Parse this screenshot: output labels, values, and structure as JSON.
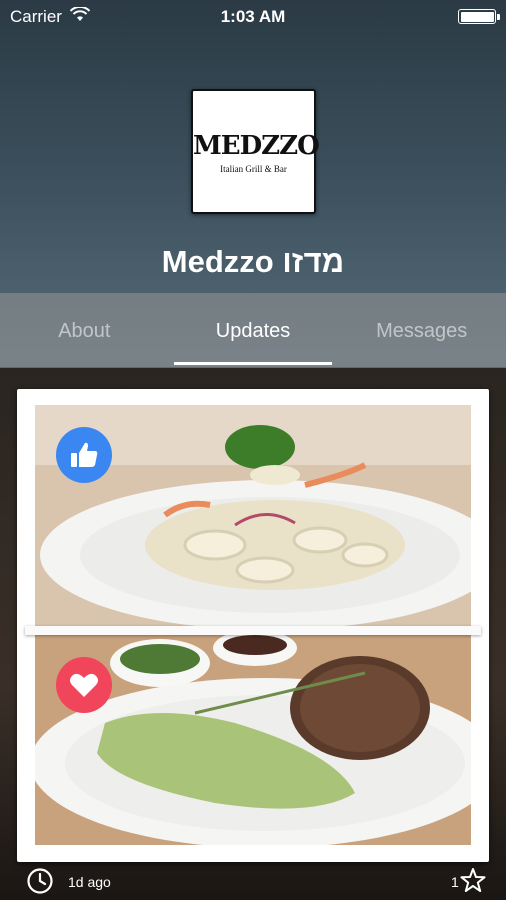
{
  "status_bar": {
    "carrier": "Carrier",
    "time": "1:03 AM"
  },
  "logo": {
    "word": "MEDZZO",
    "tagline": "Italian Grill & Bar"
  },
  "page": {
    "title": "Medzzo מדזו"
  },
  "tabs": [
    {
      "label": "About",
      "active": false
    },
    {
      "label": "Updates",
      "active": true
    },
    {
      "label": "Messages",
      "active": false
    }
  ],
  "post": {
    "photos": [
      "seafood pasta dish",
      "steak with herb mash"
    ],
    "reactions": [
      "like-icon",
      "heart-icon"
    ],
    "time_ago": "1d ago",
    "star_count": "1"
  },
  "colors": {
    "like": "#3b87f2",
    "love": "#f1455c"
  }
}
